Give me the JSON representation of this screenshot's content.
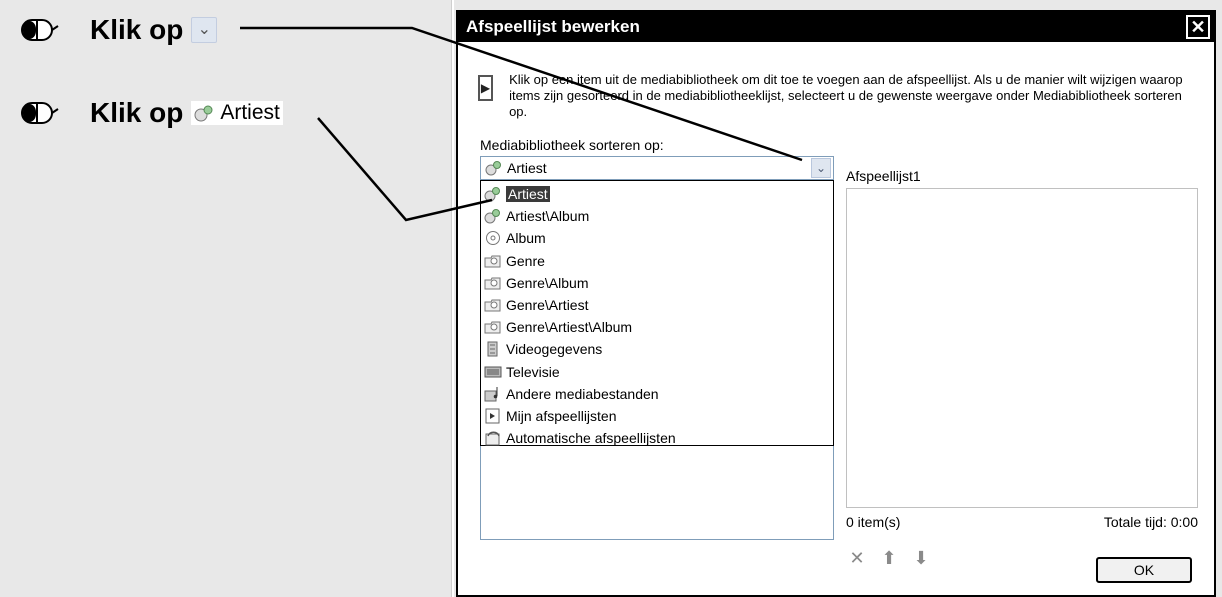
{
  "instructions": [
    {
      "text": "Klik op",
      "target_kind": "dropdown-arrow"
    },
    {
      "text": "Klik op",
      "target_label": "Artiest"
    }
  ],
  "dialog": {
    "title": "Afspeellijst bewerken",
    "close_label": "✕",
    "info": "Klik op een item uit de mediabibliotheek om dit toe te voegen aan de afspeellijst. Als u de manier wilt wijzigen waarop items zijn gesorteerd in de mediabibliotheeklijst, selecteert u de gewenste weergave onder Mediabibliotheek sorteren op.",
    "sort_label": "Mediabibliotheek sorteren op:",
    "combo_value": "Artiest",
    "combo_arrow": "⌄",
    "options": [
      {
        "label": "Artiest",
        "icon": "artist-icon",
        "selected": true
      },
      {
        "label": "Artiest\\Album",
        "icon": "artist-icon"
      },
      {
        "label": "Album",
        "icon": "cd-icon"
      },
      {
        "label": "Genre",
        "icon": "genre-folder-icon"
      },
      {
        "label": "Genre\\Album",
        "icon": "genre-folder-icon"
      },
      {
        "label": "Genre\\Artiest",
        "icon": "genre-folder-icon"
      },
      {
        "label": "Genre\\Artiest\\Album",
        "icon": "genre-folder-icon"
      },
      {
        "label": "Videogegevens",
        "icon": "video-icon"
      },
      {
        "label": "Televisie",
        "icon": "tv-icon"
      },
      {
        "label": "Andere mediabestanden",
        "icon": "media-files-icon"
      },
      {
        "label": "Mijn afspeellijsten",
        "icon": "playlist-icon"
      },
      {
        "label": "Automatische afspeellijsten",
        "icon": "auto-playlist-icon"
      }
    ],
    "playlist_name": "Afspeellijst1",
    "item_count": "0 item(s)",
    "total_time": "Totale tijd: 0:00",
    "tools": {
      "remove": "✕",
      "up": "⬆",
      "down": "⬇"
    },
    "ok_label": "OK"
  }
}
